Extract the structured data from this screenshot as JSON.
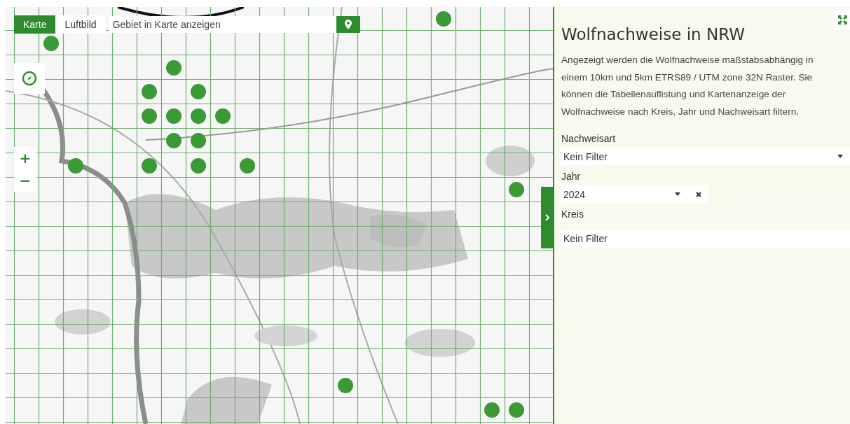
{
  "map": {
    "basemap_tabs": [
      {
        "label": "Karte",
        "selected": true
      },
      {
        "label": "Luftbild",
        "selected": false
      }
    ],
    "search": {
      "placeholder": "Gebiet in Karte anzeigen"
    },
    "zoom_in": "+",
    "zoom_out": "−"
  },
  "panel": {
    "title": "Wolfnachweise in NRW",
    "description": "Angezeigt werden die Wolfnachweise maßstabsabhängig in einem 10km und 5km ETRS89 / UTM zone 32N Raster. Sie können die Tabellenauflistung und Kartenanzeige der Wolfnachweise nach Kreis, Jahr und Nachweisart filtern.",
    "filters": [
      {
        "kind": "select",
        "label": "Nachweisart",
        "value": "Kein Filter",
        "clearable": false
      },
      {
        "kind": "select",
        "label": "Jahr",
        "value": "2024",
        "clearable": true
      },
      {
        "kind": "input",
        "label": "Kreis",
        "value": "Kein Filter"
      }
    ]
  }
}
